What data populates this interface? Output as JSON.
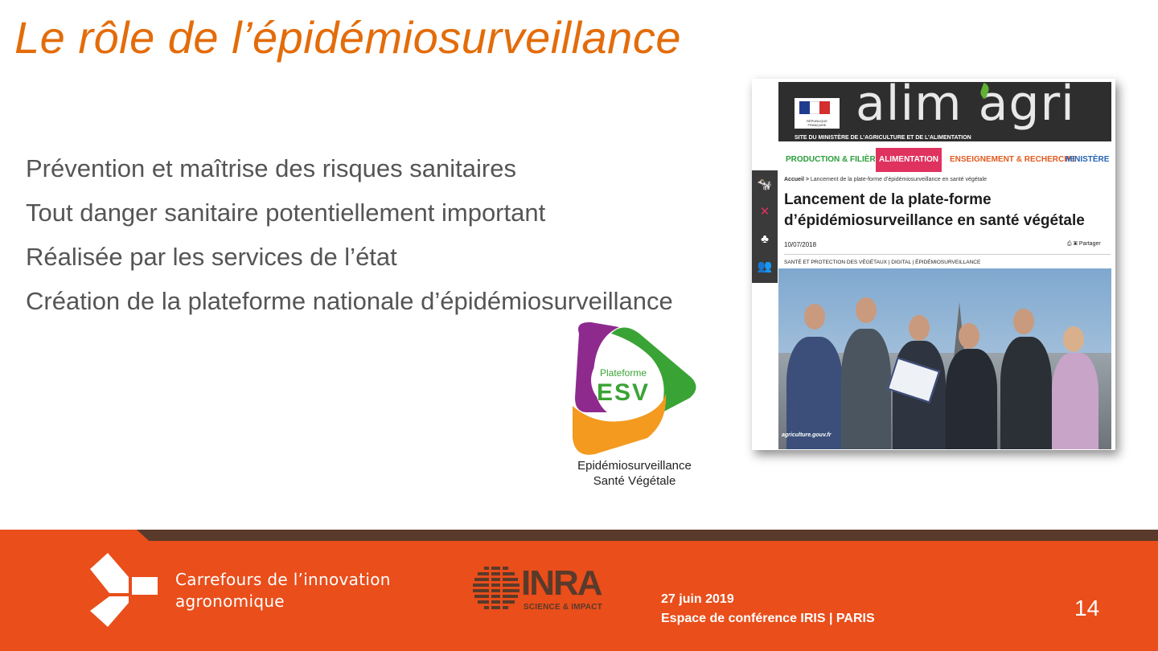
{
  "slide": {
    "title": "Le rôle de l’épidémiosurveillance",
    "bullets": [
      "Prévention et maîtrise des risques sanitaires",
      "Tout danger sanitaire potentiellement important",
      "Réalisée par les services de l’état",
      "Création de la plateforme nationale d’épidémiosurveillance"
    ],
    "page_number": "14"
  },
  "esv_logo": {
    "line1": "Plateforme",
    "line2": "ESV",
    "caption_line1": "Epidémiosurveillance",
    "caption_line2": "Santé Végétale",
    "colors": {
      "purple": "#8e2a8e",
      "green": "#3aa335",
      "orange": "#f39a1f"
    }
  },
  "article": {
    "logo": "alim agri",
    "rf_label": "RÉPUBLIQUE FRANÇAISE",
    "site_label": "SITE DU MINISTÈRE DE L’AGRICULTURE ET DE L’ALIMENTATION",
    "nav": [
      "PRODUCTION & FILIÈRES",
      "ALIMENTATION",
      "ENSEIGNEMENT & RECHERCHE",
      "MINISTÈRE"
    ],
    "breadcrumb_home": "Accueil >",
    "breadcrumb": "Lancement de la plate-forme d’épidémiosurveillance en santé végétale",
    "headline_line1": "Lancement de la plate-forme",
    "headline_line2": "d’épidémiosurveillance en santé végétale",
    "date": "10/07/2018",
    "share": "Partager",
    "tags": "SANTÉ ET PROTECTION DES VÉGÉTAUX | DIGITAL | ÉPIDÉMIOSURVEILLANCE",
    "photo_credit": "agriculture.gouv.fr"
  },
  "footer": {
    "brand_line1": "Carrefours de l’innovation",
    "brand_line2": "agronomique",
    "inra": "INRA",
    "inra_sub": "SCIENCE & IMPACT",
    "date": "27 juin 2019",
    "venue": "Espace de conférence IRIS | PARIS",
    "colors": {
      "bar": "#e94e1b",
      "stripe": "#5a3a2a"
    }
  }
}
